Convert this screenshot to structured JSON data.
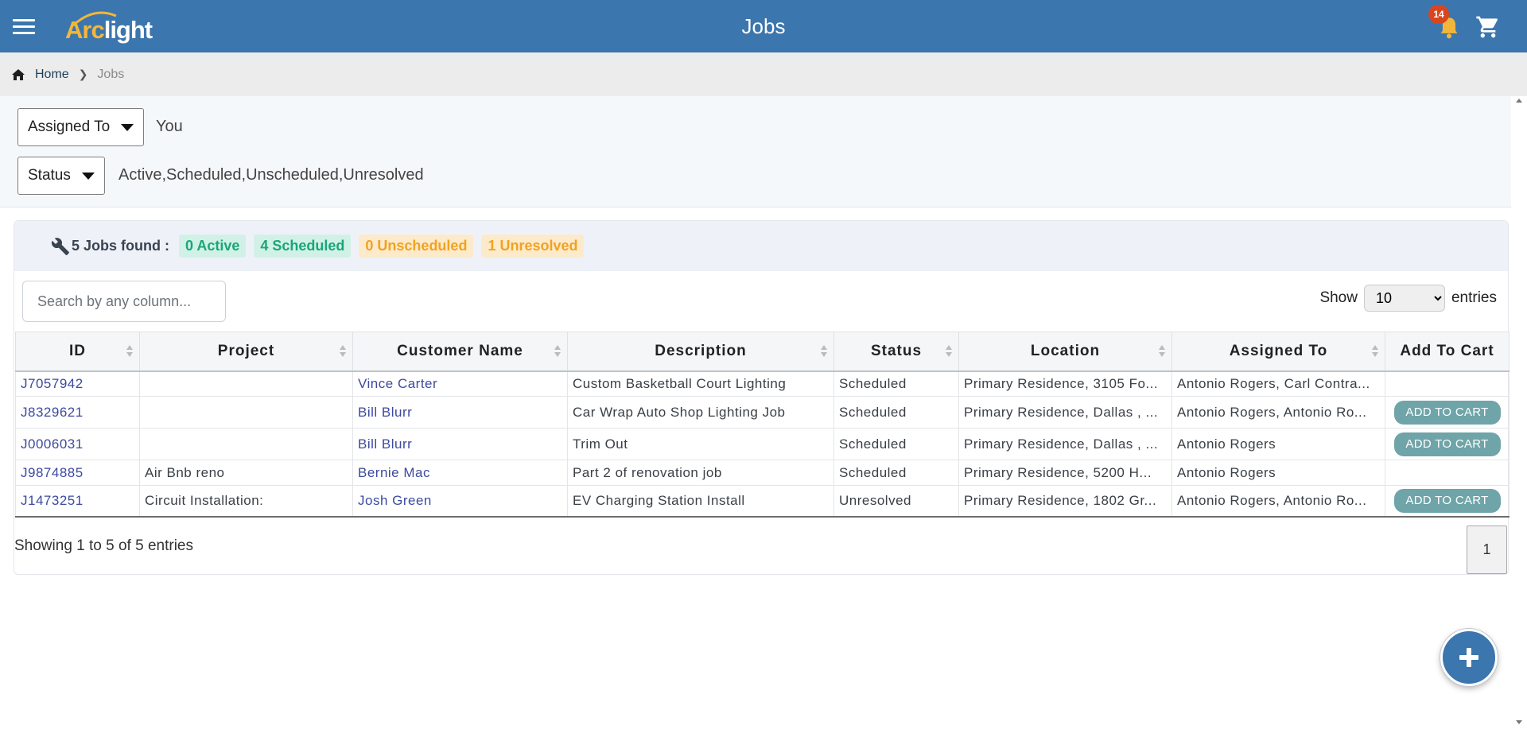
{
  "header": {
    "logo_arc": "Arc",
    "logo_light": "light",
    "title": "Jobs",
    "notification_count": "14",
    "colors": {
      "bar": "#3b76ae",
      "badge": "#d9461e",
      "bell": "#f4b63a"
    }
  },
  "breadcrumb": {
    "home": "Home",
    "current": "Jobs"
  },
  "filters": {
    "assigned_to": {
      "label": "Assigned To",
      "value": "You"
    },
    "status": {
      "label": "Status",
      "value": "Active,Scheduled,Unscheduled,Unresolved"
    }
  },
  "summary": {
    "found": "5 Jobs found :",
    "active": "0 Active",
    "scheduled": "4 Scheduled",
    "unscheduled": "0 Unscheduled",
    "unresolved": "1 Unresolved"
  },
  "search": {
    "placeholder": "Search by any column..."
  },
  "show_entries": {
    "show": "Show",
    "value": "10",
    "entries": "entries"
  },
  "table": {
    "columns": [
      "ID",
      "Project",
      "Customer Name",
      "Description",
      "Status",
      "Location",
      "Assigned To",
      "Add To Cart"
    ],
    "add_to_cart_label": "ADD TO CART",
    "rows": [
      {
        "id": "J7057942",
        "project": "",
        "customer": "Vince Carter",
        "description": "Custom Basketball Court Lighting",
        "status": "Scheduled",
        "location": "Primary Residence, 3105 Fo...",
        "assigned": "Antonio Rogers, Carl Contra...",
        "cart": false
      },
      {
        "id": "J8329621",
        "project": "",
        "customer": "Bill Blurr",
        "description": "Car Wrap Auto Shop Lighting Job",
        "status": "Scheduled",
        "location": "Primary Residence, Dallas , ...",
        "assigned": "Antonio Rogers, Antonio Ro...",
        "cart": true
      },
      {
        "id": "J0006031",
        "project": "",
        "customer": "Bill Blurr",
        "description": "Trim Out",
        "status": "Scheduled",
        "location": "Primary Residence, Dallas , ...",
        "assigned": "Antonio Rogers",
        "cart": true
      },
      {
        "id": "J9874885",
        "project": "Air Bnb reno",
        "customer": "Bernie Mac",
        "description": "Part 2 of renovation job",
        "status": "Scheduled",
        "location": "Primary Residence, 5200 H...",
        "assigned": "Antonio Rogers",
        "cart": false
      },
      {
        "id": "J1473251",
        "project": "Circuit Installation:",
        "customer": "Josh Green",
        "description": "EV Charging Station Install",
        "status": "Unresolved",
        "location": "Primary Residence, 1802 Gr...",
        "assigned": "Antonio Rogers, Antonio Ro...",
        "cart": true
      }
    ]
  },
  "pagination": {
    "info": "Showing 1 to 5 of 5 entries",
    "current_page": "1"
  },
  "icons": [
    "menu-icon",
    "notification-bell-icon",
    "cart-icon",
    "home-icon",
    "wrench-icon",
    "sort-icon",
    "plus-icon"
  ]
}
